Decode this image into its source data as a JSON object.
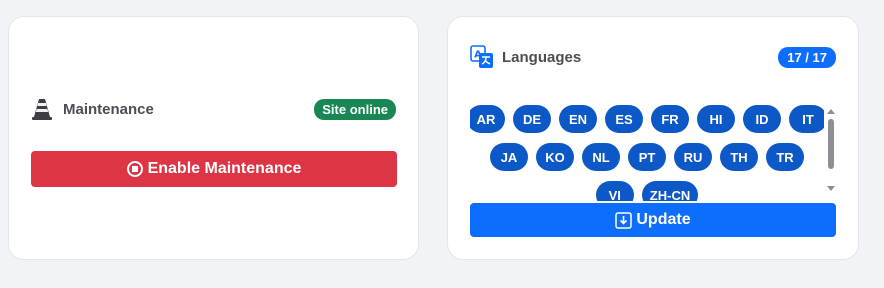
{
  "maintenance": {
    "title": "Maintenance",
    "status_badge": "Site online",
    "button_label": "Enable Maintenance",
    "icons": {
      "title": "traffic-cone-icon",
      "button": "stop-circle-icon"
    },
    "colors": {
      "badge": "#198754",
      "button": "#dc3545"
    }
  },
  "languages": {
    "title": "Languages",
    "count_badge": "17 / 17",
    "rows": [
      [
        "AR",
        "DE",
        "EN",
        "ES",
        "FR",
        "HI",
        "ID",
        "IT"
      ],
      [
        "JA",
        "KO",
        "NL",
        "PT",
        "RU",
        "TH",
        "TR"
      ],
      [
        "VI",
        "ZH-CN"
      ]
    ],
    "update_label": "Update",
    "icons": {
      "title": "translate-icon",
      "button": "download-icon"
    },
    "colors": {
      "chip": "#0d58c7",
      "badge": "#0d6efd",
      "button": "#0d6efd"
    }
  }
}
